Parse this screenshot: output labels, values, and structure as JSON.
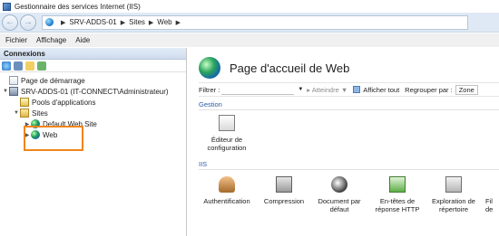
{
  "window": {
    "title": "Gestionnaire des services Internet (IIS)"
  },
  "address": {
    "crumbs": [
      "SRV-ADDS-01",
      "Sites",
      "Web"
    ]
  },
  "menu": [
    "Fichier",
    "Affichage",
    "Aide"
  ],
  "connections": {
    "header": "Connexions",
    "tree": [
      {
        "label": "Page de démarrage"
      },
      {
        "label": "SRV-ADDS-01 (IT-CONNECT\\Administrateur)"
      },
      {
        "label": "Pools d'applications"
      },
      {
        "label": "Sites"
      },
      {
        "label": "Default Web Site"
      },
      {
        "label": "Web"
      }
    ]
  },
  "main": {
    "title": "Page d'accueil de Web",
    "filter": {
      "label": "Filtrer :",
      "goto": "Atteindre",
      "show_all": "Afficher tout",
      "group_by": "Regrouper par :",
      "group_value": "Zone"
    },
    "sections": [
      {
        "name": "Gestion",
        "items": [
          {
            "label_1": "Éditeur de",
            "label_2": "configuration"
          }
        ]
      },
      {
        "name": "IIS",
        "items": [
          {
            "label_1": "Authentification",
            "label_2": ""
          },
          {
            "label_1": "Compression",
            "label_2": ""
          },
          {
            "label_1": "Document par",
            "label_2": "défaut"
          },
          {
            "label_1": "En-têtes de",
            "label_2": "réponse HTTP"
          },
          {
            "label_1": "Exploration de",
            "label_2": "répertoire"
          },
          {
            "label_1": "Fil",
            "label_2": "de"
          }
        ]
      }
    ]
  }
}
